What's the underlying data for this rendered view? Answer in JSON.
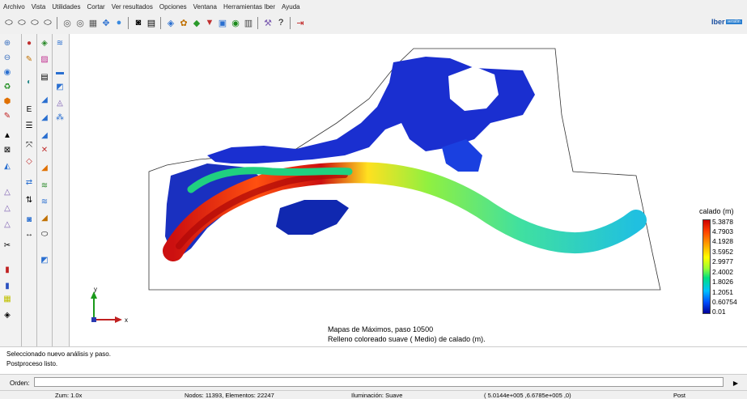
{
  "menu": [
    "Archivo",
    "Vista",
    "Utilidades",
    "Cortar",
    "Ver resultados",
    "Opciones",
    "Ventana",
    "Herramientas Iber",
    "Ayuda"
  ],
  "brand": {
    "name": "Iber",
    "sub": "versión"
  },
  "legend": {
    "title": "calado (m)",
    "values": [
      "5.3878",
      "4.7903",
      "4.1928",
      "3.5952",
      "2.9977",
      "2.4002",
      "1.8026",
      "1.2051",
      "0.60754",
      "0.01"
    ]
  },
  "axes": {
    "y": "y",
    "x": "x"
  },
  "caption": {
    "line1": "Mapas de Máximos, paso 10500",
    "line2": "Relleno coloreado suave ( Medio) de calado (m)."
  },
  "console": {
    "line1": "Seleccionado nuevo análisis y paso.",
    "line2": "Postproceso listo."
  },
  "command": {
    "label": "Orden:",
    "value": ""
  },
  "status": {
    "zoom": "Zum: 1.0x",
    "mesh": "Nodos: 11393, Elementos: 22247",
    "lighting": "Iluminación: Suave",
    "coords": "( 5.0144e+005 ,6.6785e+005 ,0)",
    "mode": "Post"
  },
  "colors": {
    "deep": "#000099",
    "high": "#cc0000",
    "mid": "#ffff00",
    "low": "#00c0ff"
  }
}
